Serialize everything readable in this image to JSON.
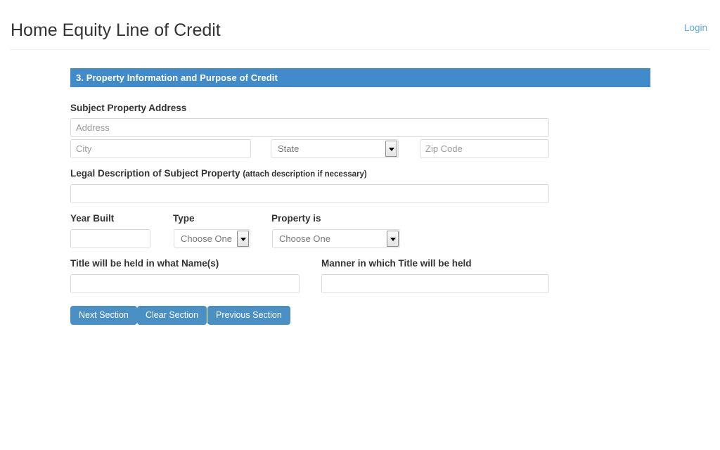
{
  "header": {
    "title": "Home Equity Line of Credit",
    "login_label": "Login"
  },
  "section": {
    "title": "3. Property Information and Purpose of Credit"
  },
  "form": {
    "address_group_label": "Subject Property Address",
    "address": {
      "placeholder": "Address",
      "value": ""
    },
    "city": {
      "placeholder": "City",
      "value": ""
    },
    "state": {
      "selected": "State"
    },
    "zip": {
      "placeholder": "Zip Code",
      "value": ""
    },
    "legal_description_label": "Legal Description of Subject Property",
    "legal_description_note": "(attach description if necessary)",
    "legal_description": {
      "placeholder": "",
      "value": ""
    },
    "year_built_label": "Year Built",
    "year_built": {
      "placeholder": "",
      "value": ""
    },
    "type_label": "Type",
    "type": {
      "selected": "Choose One"
    },
    "property_is_label": "Property is",
    "property_is": {
      "selected": "Choose One"
    },
    "title_names_label": "Title will be held in what Name(s)",
    "title_names": {
      "placeholder": "",
      "value": ""
    },
    "title_manner_label": "Manner in which Title will be held",
    "title_manner": {
      "placeholder": "",
      "value": ""
    }
  },
  "buttons": {
    "next": "Next Section",
    "clear": "Clear Section",
    "previous": "Previous Section"
  },
  "colors": {
    "accent": "#428bca",
    "button": "#4a90c4",
    "link": "#5bade0",
    "text": "#333333",
    "placeholder": "#9a9a9a",
    "border": "#dddddd"
  }
}
